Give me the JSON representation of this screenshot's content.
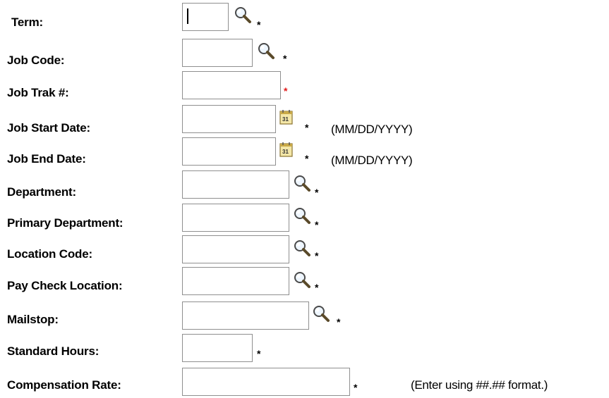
{
  "form": {
    "fields": [
      {
        "key": "term",
        "label": "Term:",
        "value": "",
        "required": "*",
        "lookup_icon": "magnifier-icon"
      },
      {
        "key": "job_code",
        "label": "Job Code:",
        "value": "",
        "required": "*",
        "lookup_icon": "magnifier-icon"
      },
      {
        "key": "job_trak",
        "label": "Job Trak #:",
        "value": "",
        "required": "*",
        "required_color": "#e21a1a"
      },
      {
        "key": "job_start_date",
        "label": "Job Start Date:",
        "value": "",
        "required": "*",
        "calendar_icon": "calendar-icon",
        "hint": "(MM/DD/YYYY)"
      },
      {
        "key": "job_end_date",
        "label": "Job End Date:",
        "value": "",
        "required": "*",
        "calendar_icon": "calendar-icon",
        "hint": "(MM/DD/YYYY)"
      },
      {
        "key": "department",
        "label": "Department:",
        "value": "",
        "required": "*",
        "lookup_icon": "magnifier-icon"
      },
      {
        "key": "primary_department",
        "label": "Primary Department:",
        "value": "",
        "required": "*",
        "lookup_icon": "magnifier-icon"
      },
      {
        "key": "location_code",
        "label": "Location Code:",
        "value": "",
        "required": "*",
        "lookup_icon": "magnifier-icon"
      },
      {
        "key": "pay_check_location",
        "label": "Pay Check Location:",
        "value": "",
        "required": "*",
        "lookup_icon": "magnifier-icon"
      },
      {
        "key": "mailstop",
        "label": "Mailstop:",
        "value": "",
        "required": "*",
        "lookup_icon": "magnifier-icon"
      },
      {
        "key": "standard_hours",
        "label": "Standard Hours:",
        "value": "",
        "required": "*"
      },
      {
        "key": "compensation_rate",
        "label": "Compensation Rate:",
        "value": "",
        "required": "*",
        "hint": "(Enter using ##.## format.)"
      }
    ]
  }
}
